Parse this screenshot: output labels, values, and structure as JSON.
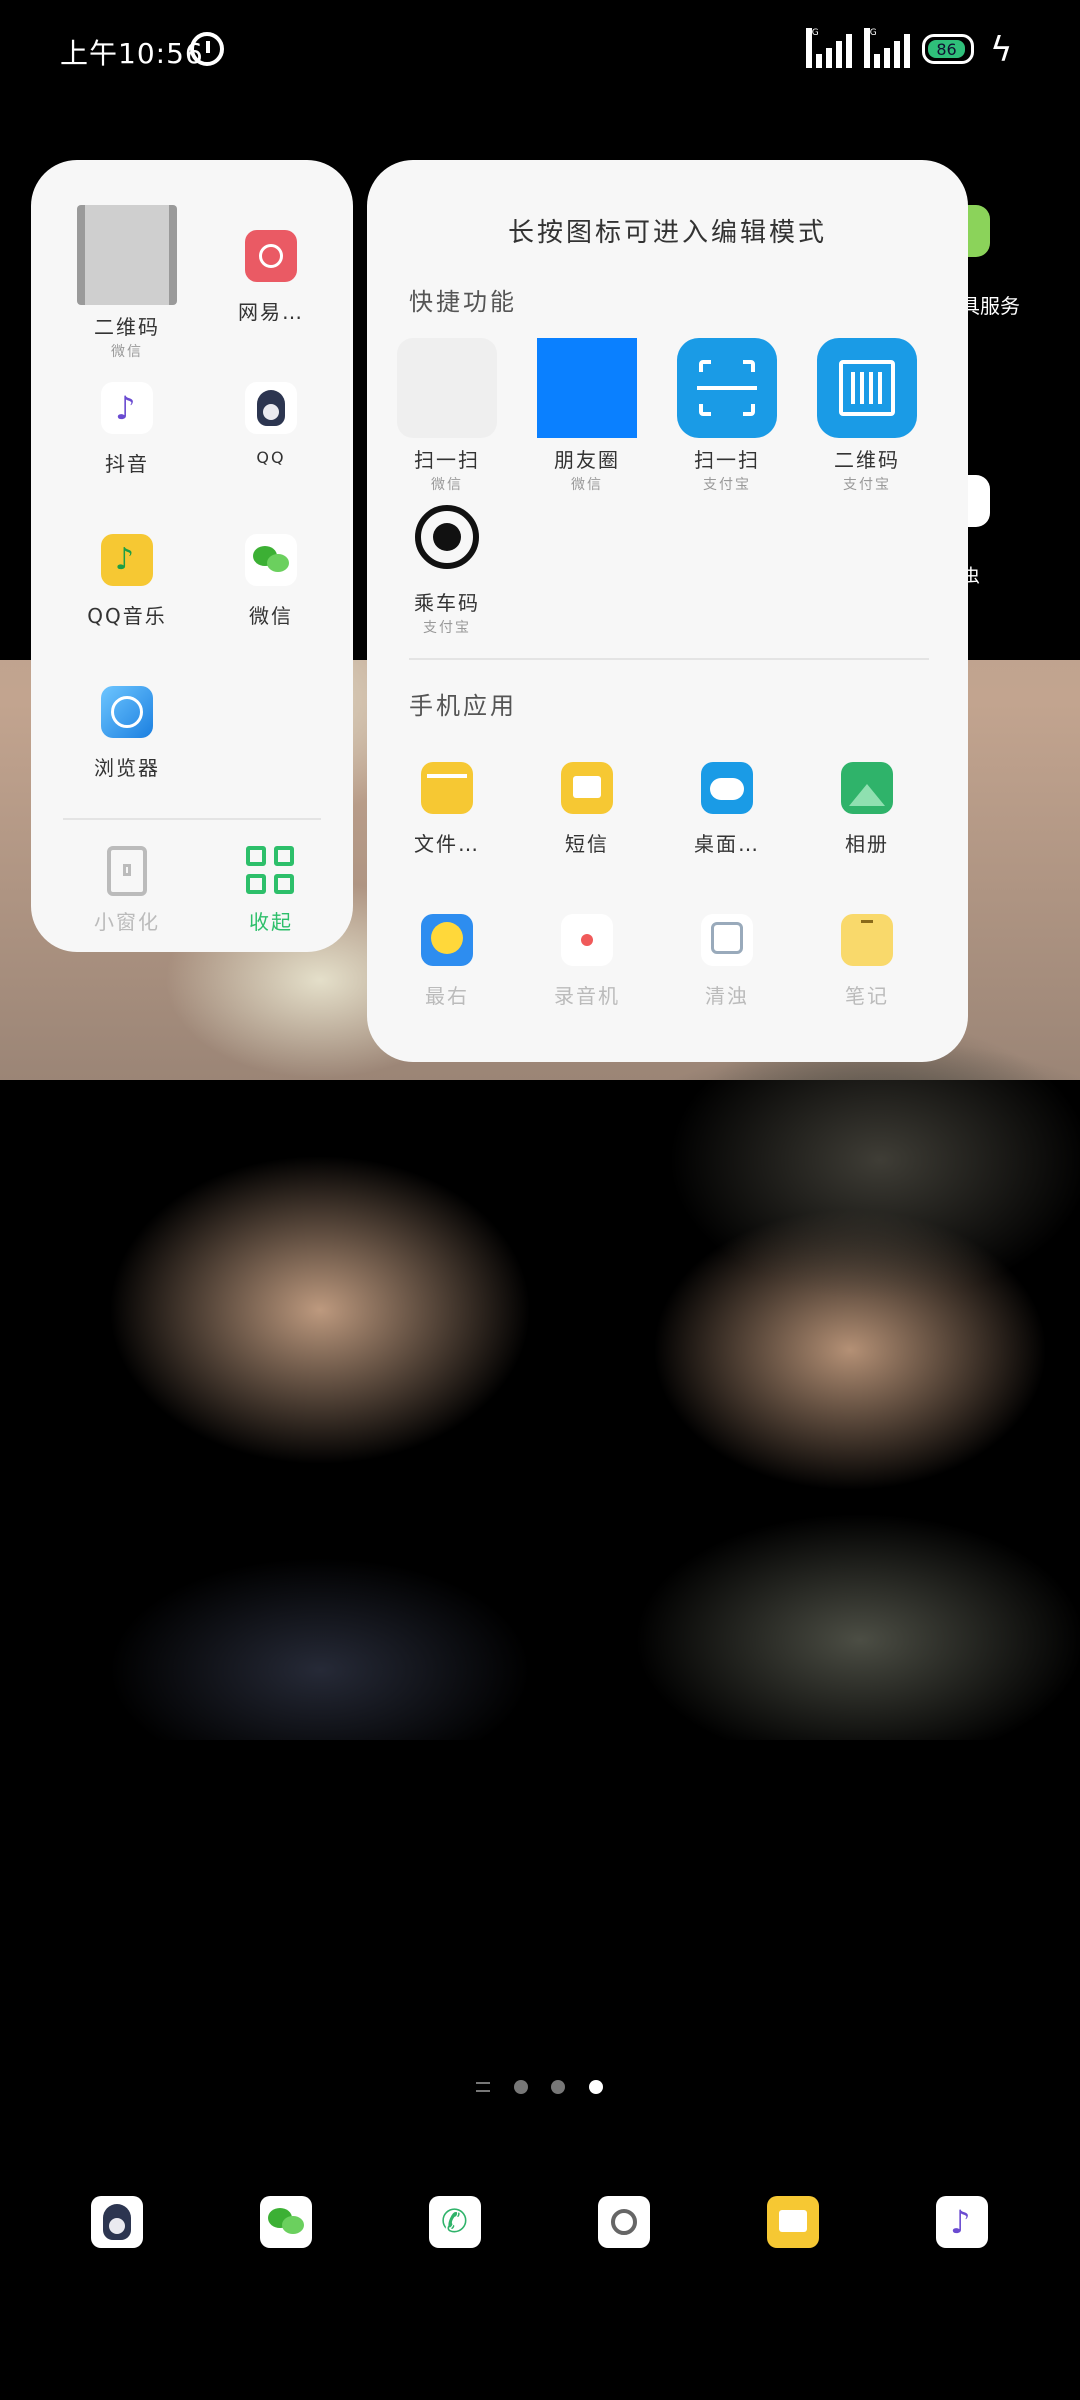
{
  "status_bar": {
    "time": "上午10:56",
    "signal1_label": "5G",
    "signal2_label": "5G",
    "battery": "86"
  },
  "edge": {
    "right_label_top": "具服务",
    "right_label_mid": "虫"
  },
  "left_panel": {
    "apps": [
      {
        "label": "二维码",
        "sub": "微信"
      },
      {
        "label": "网易…",
        "sub": ""
      },
      {
        "label": "抖音",
        "sub": ""
      },
      {
        "label": "QQ",
        "sub": ""
      },
      {
        "label": "QQ音乐",
        "sub": ""
      },
      {
        "label": "微信",
        "sub": ""
      },
      {
        "label": "浏览器",
        "sub": ""
      }
    ],
    "bottom": {
      "window_label": "小窗化",
      "collapse_label": "收起"
    }
  },
  "right_panel": {
    "title": "长按图标可进入编辑模式",
    "shortcuts_header": "快捷功能",
    "shortcuts": [
      {
        "label": "扫一扫",
        "sub": "微信"
      },
      {
        "label": "朋友圈",
        "sub": "微信"
      },
      {
        "label": "扫一扫",
        "sub": "支付宝"
      },
      {
        "label": "二维码",
        "sub": "支付宝"
      },
      {
        "label": "乘车码",
        "sub": "支付宝"
      }
    ],
    "apps_header": "手机应用",
    "apps": [
      {
        "label": "文件…"
      },
      {
        "label": "短信"
      },
      {
        "label": "桌面…"
      },
      {
        "label": "相册"
      },
      {
        "label": "最右"
      },
      {
        "label": "录音机"
      },
      {
        "label": "清浊"
      },
      {
        "label": "笔记"
      }
    ]
  },
  "colors": {
    "accent_green": "#2dbf6a",
    "alipay_blue": "#1a9be6",
    "panel_bg": "#f7f7f7"
  }
}
